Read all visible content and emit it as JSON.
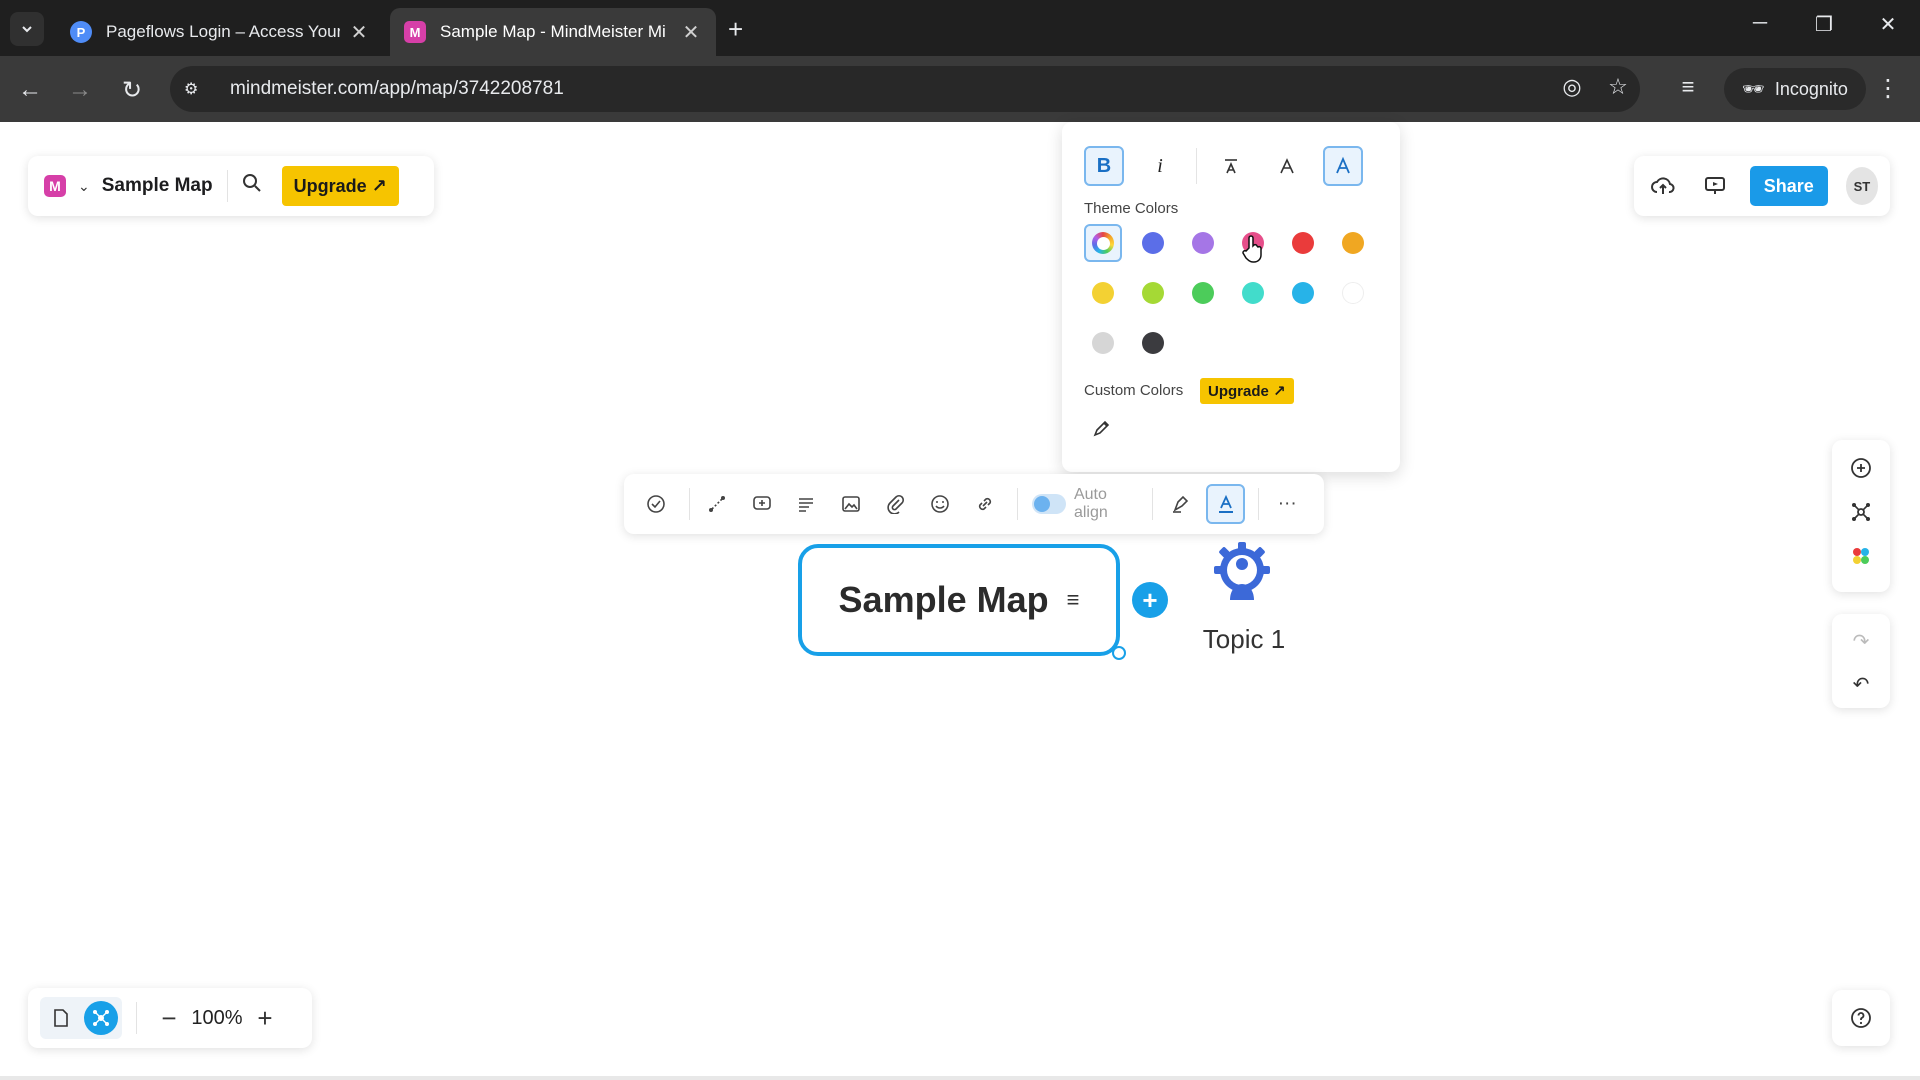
{
  "browser": {
    "tabs": [
      {
        "title": "Pageflows Login – Access Your",
        "favicon": "P"
      },
      {
        "title": "Sample Map - MindMeister Mi",
        "favicon": "M"
      }
    ],
    "url": "mindmeister.com/app/map/3742208781",
    "incognito_label": "Incognito"
  },
  "header": {
    "map_name": "Sample Map",
    "upgrade_label": "Upgrade ↗",
    "share_label": "Share",
    "avatar_initials": "ST"
  },
  "popover": {
    "bold_label": "B",
    "italic_label": "i",
    "theme_colors_label": "Theme Colors",
    "custom_colors_label": "Custom Colors",
    "upgrade_label": "Upgrade ↗",
    "theme_colors": [
      "#5b6ee8",
      "#a576e6",
      "#e64e8a",
      "#ea3b3b",
      "#f0a722",
      "#f3d133",
      "#a5d935",
      "#4ccc5a",
      "#42dccb",
      "#27b3e8",
      "#ffffff",
      "#d6d6d6",
      "#3b3b3f"
    ]
  },
  "node_toolbar": {
    "auto_align_label": "Auto align",
    "more_label": "···"
  },
  "map": {
    "root_label": "Sample Map",
    "child_label": "Topic 1"
  },
  "zoom": {
    "value": "100%"
  }
}
